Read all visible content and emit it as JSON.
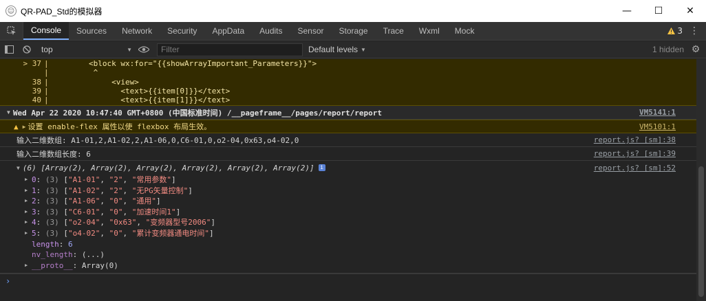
{
  "window": {
    "title": "QR-PAD_Std的模拟器",
    "minimize": "—",
    "maximize": "☐",
    "close": "✕"
  },
  "tabs": [
    {
      "label": "Console",
      "active": true
    },
    {
      "label": "Sources"
    },
    {
      "label": "Network"
    },
    {
      "label": "Security"
    },
    {
      "label": "AppData"
    },
    {
      "label": "Audits"
    },
    {
      "label": "Sensor"
    },
    {
      "label": "Storage"
    },
    {
      "label": "Trace"
    },
    {
      "label": "Wxml"
    },
    {
      "label": "Mock"
    }
  ],
  "tabbar": {
    "warning_count": "3"
  },
  "toolbar": {
    "context": "top",
    "filter_placeholder": "Filter",
    "levels": "Default levels",
    "hidden": "1 hidden"
  },
  "codeframe": [
    {
      "num": "> 37",
      "bar": "|",
      "code": "        <block wx:for=\"{{showArrayImportant_Parameters}}\">"
    },
    {
      "num": "",
      "bar": "|",
      "code": "         ^"
    },
    {
      "num": "38",
      "bar": "|",
      "code": "             <view>"
    },
    {
      "num": "39",
      "bar": "|",
      "code": "               <text>{{item[0]}}</text>"
    },
    {
      "num": "40",
      "bar": "|",
      "code": "               <text>{{item[1]}}</text>"
    }
  ],
  "messages": {
    "group": {
      "text": "Wed Apr 22 2020 10:47:40 GMT+0800 (中国标准时间) /__pageframe__/pages/report/report",
      "source": "VM5141:1"
    },
    "warning": {
      "text": "设置 enable-flex 属性以使 flexbox 布局生效。",
      "source": "VM5101:1"
    },
    "log1": {
      "text": "输入二维数组: A1-01,2,A1-02,2,A1-06,0,C6-01,0,o2-04,0x63,o4-02,0",
      "source": "report.js? [sm]:38"
    },
    "log2": {
      "text": "输入二维数组长度: 6",
      "source": "report.js? [sm]:39"
    }
  },
  "array": {
    "head": "(6) [Array(2), Array(2), Array(2), Array(2), Array(2), Array(2)]",
    "source": "report.js? [sm]:52",
    "items": [
      {
        "idx": "0",
        "count": "(3)",
        "a": "\"A1-01\"",
        "b": "\"2\"",
        "c": "\"常用参数\""
      },
      {
        "idx": "1",
        "count": "(3)",
        "a": "\"A1-02\"",
        "b": "\"2\"",
        "c": "\"无PG矢量控制\""
      },
      {
        "idx": "2",
        "count": "(3)",
        "a": "\"A1-06\"",
        "b": "\"0\"",
        "c": "\"通用\""
      },
      {
        "idx": "3",
        "count": "(3)",
        "a": "\"C6-01\"",
        "b": "\"0\"",
        "c": "\"加速时间1\""
      },
      {
        "idx": "4",
        "count": "(3)",
        "a": "\"o2-04\"",
        "b": "\"0x63\"",
        "c": "\"变频器型号2006\""
      },
      {
        "idx": "5",
        "count": "(3)",
        "a": "\"o4-02\"",
        "b": "\"0\"",
        "c": "\"累计变频器通电时间\""
      }
    ],
    "length_key": "length",
    "length_val": "6",
    "nv_key": "nv_length",
    "nv_val": "(...)",
    "proto_key": "__proto__",
    "proto_val": "Array(0)"
  },
  "prompt": "›"
}
